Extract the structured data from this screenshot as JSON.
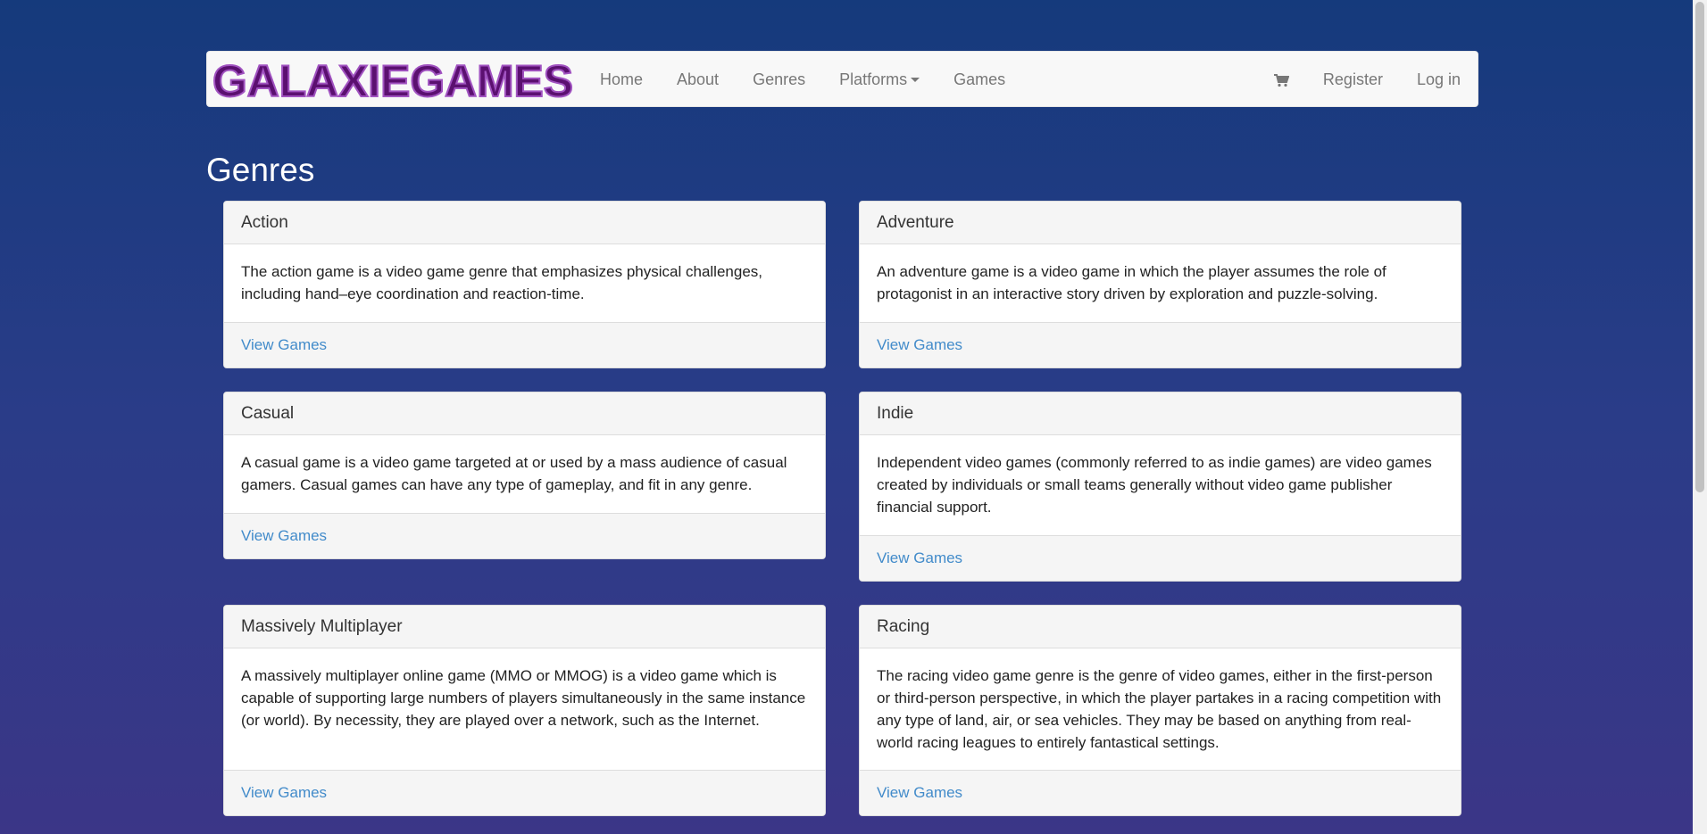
{
  "brand": {
    "name": "GALAXIEGAMES",
    "color": "#5b1070"
  },
  "nav": {
    "left": [
      {
        "label": "Home"
      },
      {
        "label": "About"
      },
      {
        "label": "Genres"
      },
      {
        "label": "Platforms"
      },
      {
        "label": "Games"
      }
    ],
    "right": {
      "cart_icon": "cart-icon",
      "register": "Register",
      "login": "Log in"
    }
  },
  "page": {
    "title": "Genres"
  },
  "genres": [
    {
      "name": "Action",
      "description": "The action game is a video game genre that emphasizes physical challenges, including hand–eye coordination and reaction-time.",
      "link": "View Games"
    },
    {
      "name": "Adventure",
      "description": "An adventure game is a video game in which the player assumes the role of protagonist in an interactive story driven by exploration and puzzle-solving.",
      "link": "View Games"
    },
    {
      "name": "Casual",
      "description": "A casual game is a video game targeted at or used by a mass audience of casual gamers. Casual games can have any type of gameplay, and fit in any genre.",
      "link": "View Games"
    },
    {
      "name": "Indie",
      "description": "Independent video games (commonly referred to as indie games) are video games created by individuals or small teams generally without video game publisher financial support.",
      "link": "View Games"
    },
    {
      "name": "Massively Multiplayer",
      "description": "A massively multiplayer online game (MMO or MMOG) is a video game which is capable of supporting large numbers of players simultaneously in the same instance (or world). By necessity, they are played over a network, such as the Internet.",
      "link": "View Games"
    },
    {
      "name": "Racing",
      "description": "The racing video game genre is the genre of video games, either in the first-person or third-person perspective, in which the player partakes in a racing competition with any type of land, air, or sea vehicles. They may be based on anything from real-world racing leagues to entirely fantastical settings.",
      "link": "View Games"
    }
  ],
  "colors": {
    "link": "#428bca",
    "navbar_bg": "#f8f8f8"
  }
}
